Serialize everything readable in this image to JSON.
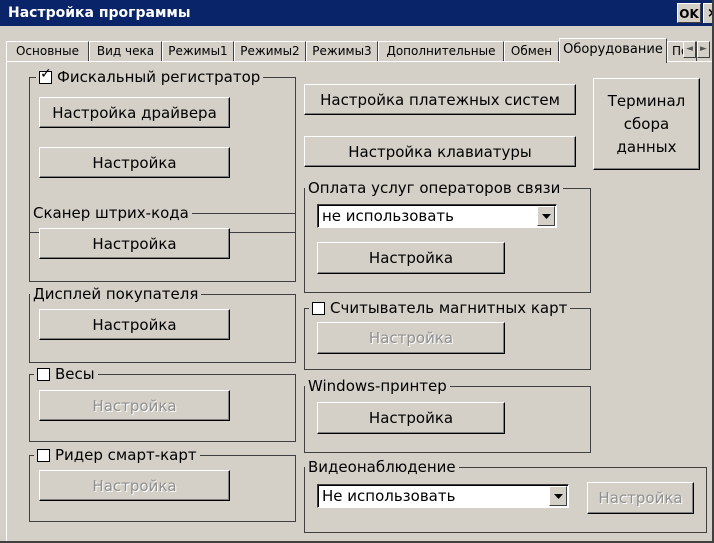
{
  "window": {
    "title": "Настройка программы",
    "ok_label": "OK",
    "close_label": "×"
  },
  "tabs": [
    {
      "label": "Основные",
      "active": false
    },
    {
      "label": "Вид чека",
      "active": false
    },
    {
      "label": "Режимы1",
      "active": false
    },
    {
      "label": "Режимы2",
      "active": false
    },
    {
      "label": "Режимы3",
      "active": false
    },
    {
      "label": "Дополнительные",
      "active": false
    },
    {
      "label": "Обмен",
      "active": false
    },
    {
      "label": "Оборудование",
      "active": true
    },
    {
      "label": "По",
      "active": false
    }
  ],
  "tab_scroll": {
    "left_icon": "◄",
    "right_icon": "►"
  },
  "groups": {
    "fiscal": {
      "label": "Фискальный регистратор",
      "checked": true,
      "driver_button": "Настройка драйвера",
      "settings_button": "Настройка"
    },
    "scanner": {
      "label": "Сканер штрих-кода",
      "settings_button": "Настройка"
    },
    "display": {
      "label": "Дисплей покупателя",
      "settings_button": "Настройка"
    },
    "scales": {
      "label": "Весы",
      "checked": false,
      "settings_button": "Настройка",
      "settings_enabled": false
    },
    "smartcard": {
      "label": "Ридер смарт-карт",
      "checked": false,
      "settings_button": "Настройка",
      "settings_enabled": false
    },
    "telecom": {
      "label": "Оплата услуг операторов связи",
      "select_value": "не использовать",
      "settings_button": "Настройка"
    },
    "magnetic": {
      "label": "Считыватель магнитных карт",
      "checked": false,
      "settings_button": "Настройка",
      "settings_enabled": false
    },
    "winprinter": {
      "label": "Windows-принтер",
      "settings_button": "Настройка"
    },
    "video": {
      "label": "Видеонаблюдение",
      "select_value": "Не использовать",
      "settings_button": "Настройка",
      "settings_enabled": false
    }
  },
  "buttons": {
    "payment_systems": "Настройка платежных систем",
    "keyboard": "Настройка клавиатуры",
    "terminal_line1": "Терминал",
    "terminal_line2": "сбора",
    "terminal_line3": "данных"
  },
  "colors": {
    "titlebar": "#0a246a",
    "face": "#d4d0c8",
    "disabled_text": "#8f8f8f"
  },
  "icons": [
    "check-icon",
    "dropdown-arrow-icon",
    "scroll-left-icon",
    "scroll-right-icon",
    "close-icon"
  ]
}
